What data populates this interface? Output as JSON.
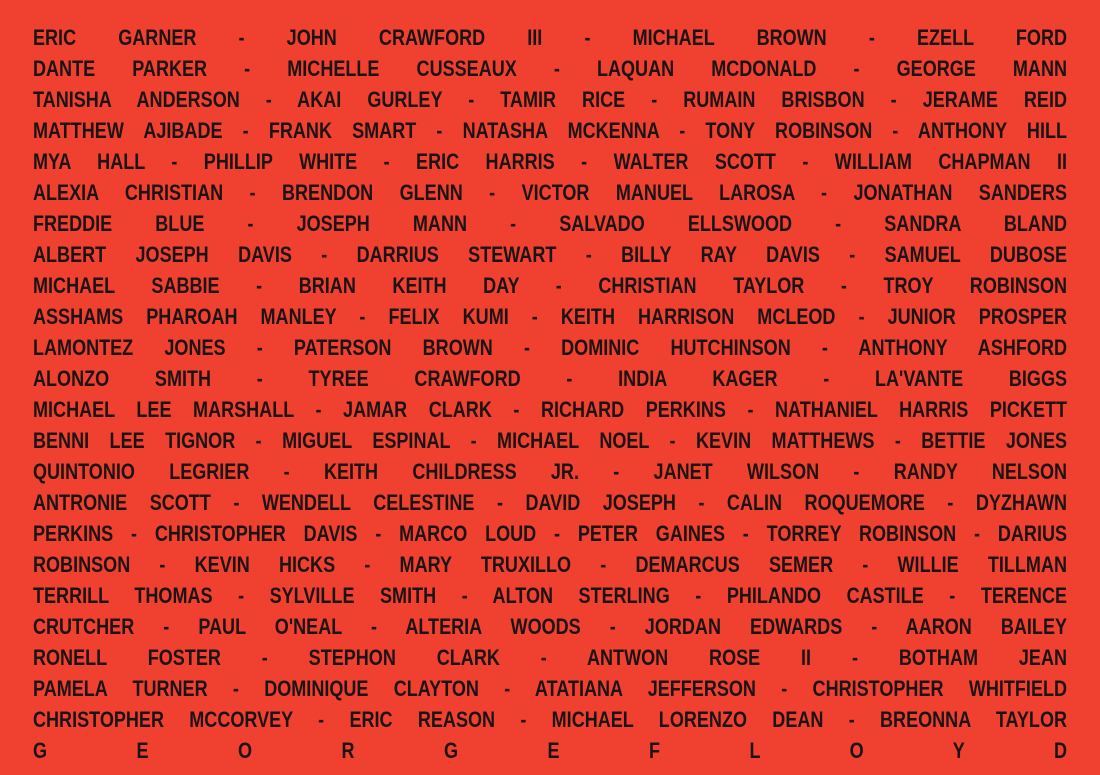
{
  "colors": {
    "background": "#f04130",
    "text": "#1c1414"
  },
  "lines": [
    "ERIC GARNER - JOHN CRAWFORD III - MICHAEL BROWN - EZELL FORD",
    "DANTE PARKER - MICHELLE CUSSEAUX - LAQUAN MCDONALD - GEORGE MANN",
    "TANISHA ANDERSON - AKAI GURLEY - TAMIR RICE - RUMAIN BRISBON - JERAME REID",
    "MATTHEW AJIBADE - FRANK SMART - NATASHA MCKENNA - TONY ROBINSON - ANTHONY HILL",
    "MYA HALL - PHILLIP WHITE - ERIC HARRIS - WALTER SCOTT - WILLIAM CHAPMAN II",
    "ALEXIA CHRISTIAN - BRENDON GLENN - VICTOR MANUEL LAROSA - JONATHAN SANDERS",
    "FREDDIE BLUE - JOSEPH MANN - SALVADO ELLSWOOD - SANDRA BLAND",
    "ALBERT JOSEPH DAVIS - DARRIUS STEWART - BILLY RAY DAVIS - SAMUEL DUBOSE",
    "MICHAEL SABBIE - BRIAN KEITH DAY - CHRISTIAN TAYLOR - TROY ROBINSON",
    "ASSHAMS PHAROAH MANLEY - FELIX KUMI - KEITH HARRISON MCLEOD - JUNIOR PROSPER",
    "LAMONTEZ JONES - PATERSON BROWN - DOMINIC HUTCHINSON - ANTHONY ASHFORD",
    "ALONZO SMITH - TYREE CRAWFORD - INDIA KAGER - LA'VANTE BIGGS",
    "MICHAEL LEE MARSHALL - JAMAR CLARK - RICHARD PERKINS - NATHANIEL HARRIS PICKETT",
    "BENNI LEE TIGNOR - MIGUEL ESPINAL - MICHAEL NOEL - KEVIN MATTHEWS - BETTIE JONES",
    "QUINTONIO LEGRIER - KEITH CHILDRESS JR. - JANET WILSON - RANDY NELSON",
    "ANTRONIE SCOTT - WENDELL CELESTINE - DAVID JOSEPH - CALIN ROQUEMORE - DYZHAWN",
    "PERKINS - CHRISTOPHER DAVIS - MARCO LOUD - PETER GAINES - TORREY ROBINSON - DARIUS",
    "ROBINSON - KEVIN HICKS - MARY TRUXILLO - DEMARCUS SEMER - WILLIE TILLMAN",
    "TERRILL THOMAS - SYLVILLE SMITH - ALTON STERLING - PHILANDO CASTILE - TERENCE",
    "CRUTCHER - PAUL O'NEAL - ALTERIA WOODS - JORDAN EDWARDS - AARON BAILEY",
    "RONELL FOSTER - STEPHON CLARK - ANTWON ROSE II - BOTHAM JEAN",
    "PAMELA TURNER - DOMINIQUE CLAYTON - ATATIANA JEFFERSON - CHRISTOPHER WHITFIELD",
    "CHRISTOPHER MCCORVEY - ERIC REASON - MICHAEL LORENZO DEAN - BREONNA TAYLOR",
    "G E O R G E F L O Y D"
  ]
}
